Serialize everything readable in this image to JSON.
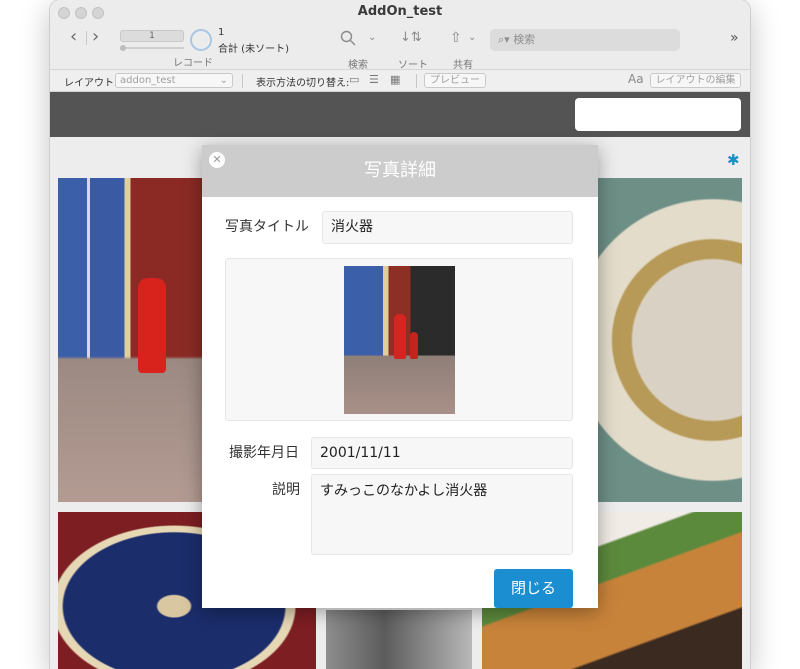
{
  "window": {
    "title": "AddOn_test"
  },
  "toolbar": {
    "record_value": "1",
    "record_caption": "レコード",
    "count_value": "1",
    "total_label": "合計 (未ソート)",
    "find_label": "検索",
    "sort_label": "ソート",
    "share_label": "共有",
    "search_placeholder": "検索",
    "overflow_icon": "chevron-double-right-icon"
  },
  "layout_bar": {
    "layout_label": "レイアウト:",
    "layout_value": "addon_test",
    "view_as_label": "表示方法の切り替え:",
    "preview_label": "プレビュー",
    "font_icon": "Aa",
    "edit_layout_label": "レイアウトの編集"
  },
  "modal": {
    "title": "写真詳細",
    "photo_title_label": "写真タイトル",
    "photo_title_value": "消火器",
    "date_label": "撮影年月日",
    "date_value": "2001/11/11",
    "description_label": "説明",
    "description_value": "すみっこのなかよし消火器",
    "close_button_label": "閉じる"
  },
  "colors": {
    "accent": "#1b8ed1",
    "header_dark": "#545454",
    "modal_header": "#cccccc"
  }
}
